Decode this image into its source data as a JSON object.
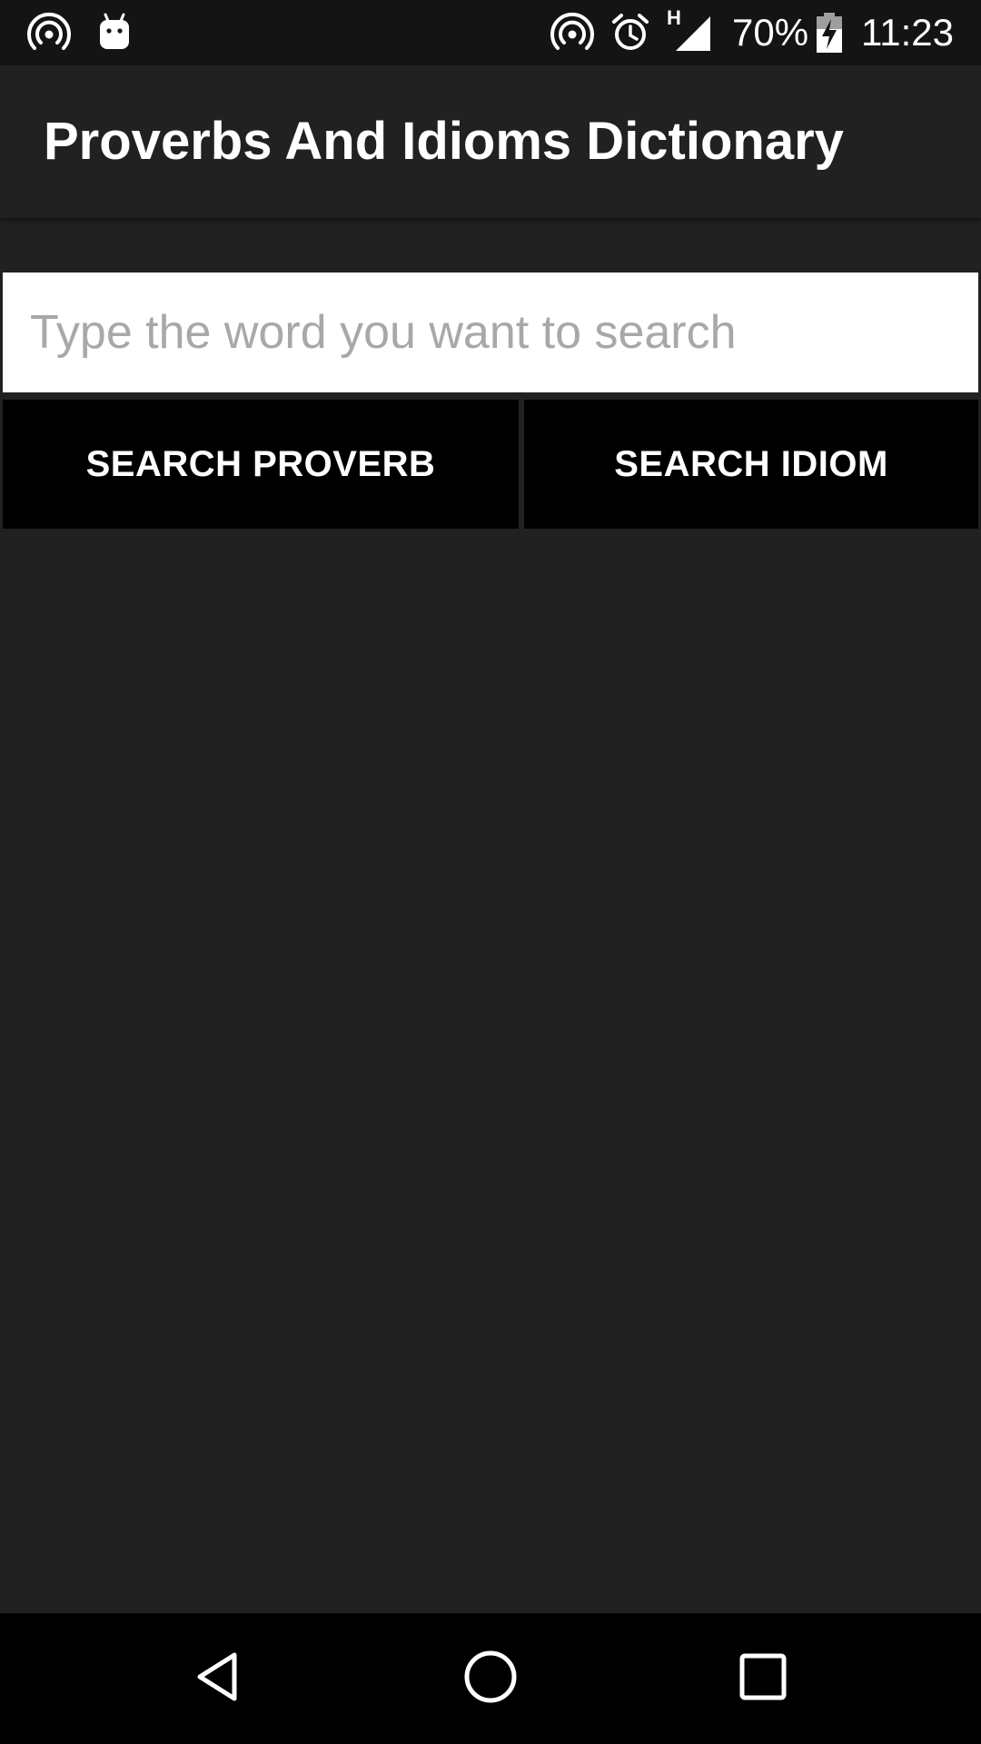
{
  "status_bar": {
    "battery": "70%",
    "network": "H",
    "time": "11:23",
    "icons": [
      "hotspot-icon",
      "android-icon",
      "hotspot-icon",
      "alarm-icon",
      "signal-icon",
      "battery-charging-icon"
    ]
  },
  "app_bar": {
    "title": "Proverbs And Idioms Dictionary"
  },
  "search": {
    "value": "",
    "placeholder": "Type the word you want to search"
  },
  "buttons": {
    "proverb": "SEARCH PROVERB",
    "idiom": "SEARCH IDIOM"
  },
  "nav_bar": {
    "icons": [
      "back-icon",
      "home-icon",
      "recents-icon"
    ]
  },
  "colors": {
    "background": "#212121",
    "status_bar": "#141414",
    "button": "#000000",
    "input": "#ffffff",
    "placeholder": "#a8a8a8"
  }
}
